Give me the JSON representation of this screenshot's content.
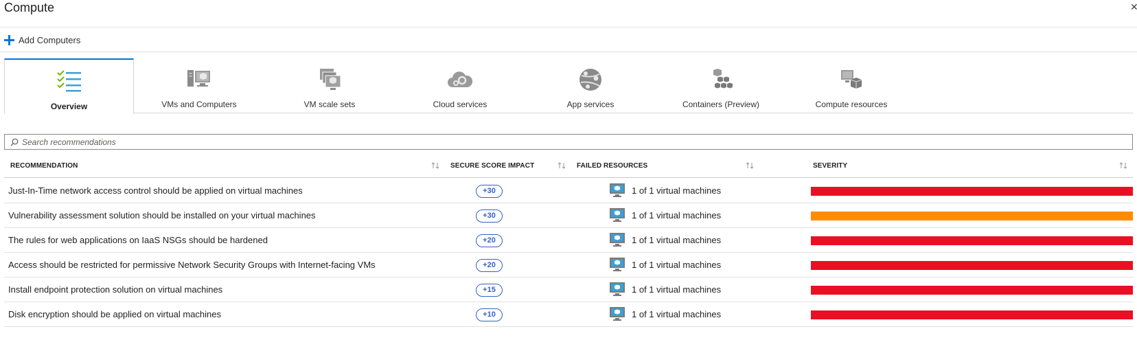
{
  "header": {
    "title": "Compute",
    "close_glyph": "✕"
  },
  "toolbar": {
    "add_label": "Add Computers",
    "add_icon": "plus-icon"
  },
  "tabs": [
    {
      "label": "Overview",
      "icon": "checklist-icon",
      "active": true
    },
    {
      "label": "VMs and Computers",
      "icon": "vm-computers-icon",
      "active": false
    },
    {
      "label": "VM scale sets",
      "icon": "scale-sets-icon",
      "active": false
    },
    {
      "label": "Cloud services",
      "icon": "cloud-services-icon",
      "active": false
    },
    {
      "label": "App services",
      "icon": "app-services-icon",
      "active": false
    },
    {
      "label": "Containers (Preview)",
      "icon": "containers-icon",
      "active": false
    },
    {
      "label": "Compute resources",
      "icon": "compute-resources-icon",
      "active": false
    }
  ],
  "search": {
    "placeholder": "Search recommendations",
    "value": ""
  },
  "table": {
    "columns": [
      "RECOMMENDATION",
      "SECURE SCORE IMPACT",
      "FAILED RESOURCES",
      "SEVERITY"
    ],
    "rows": [
      {
        "recommendation": "Just-In-Time network access control should be applied on virtual machines",
        "impact": "+30",
        "failed": "1 of 1 virtual machines",
        "severity": "high"
      },
      {
        "recommendation": "Vulnerability assessment solution should be installed on your virtual machines",
        "impact": "+30",
        "failed": "1 of 1 virtual machines",
        "severity": "medium"
      },
      {
        "recommendation": "The rules for web applications on IaaS NSGs should be hardened",
        "impact": "+20",
        "failed": "1 of 1 virtual machines",
        "severity": "high"
      },
      {
        "recommendation": "Access should be restricted for permissive Network Security Groups with Internet-facing VMs",
        "impact": "+20",
        "failed": "1 of 1 virtual machines",
        "severity": "high"
      },
      {
        "recommendation": "Install endpoint protection solution on virtual machines",
        "impact": "+15",
        "failed": "1 of 1 virtual machines",
        "severity": "high"
      },
      {
        "recommendation": "Disk encryption should be applied on virtual machines",
        "impact": "+10",
        "failed": "1 of 1 virtual machines",
        "severity": "high"
      }
    ]
  },
  "colors": {
    "accent": "#0078d4",
    "severity_high": "#e81123",
    "severity_medium": "#ff8c00",
    "pill": "#3460c8"
  }
}
